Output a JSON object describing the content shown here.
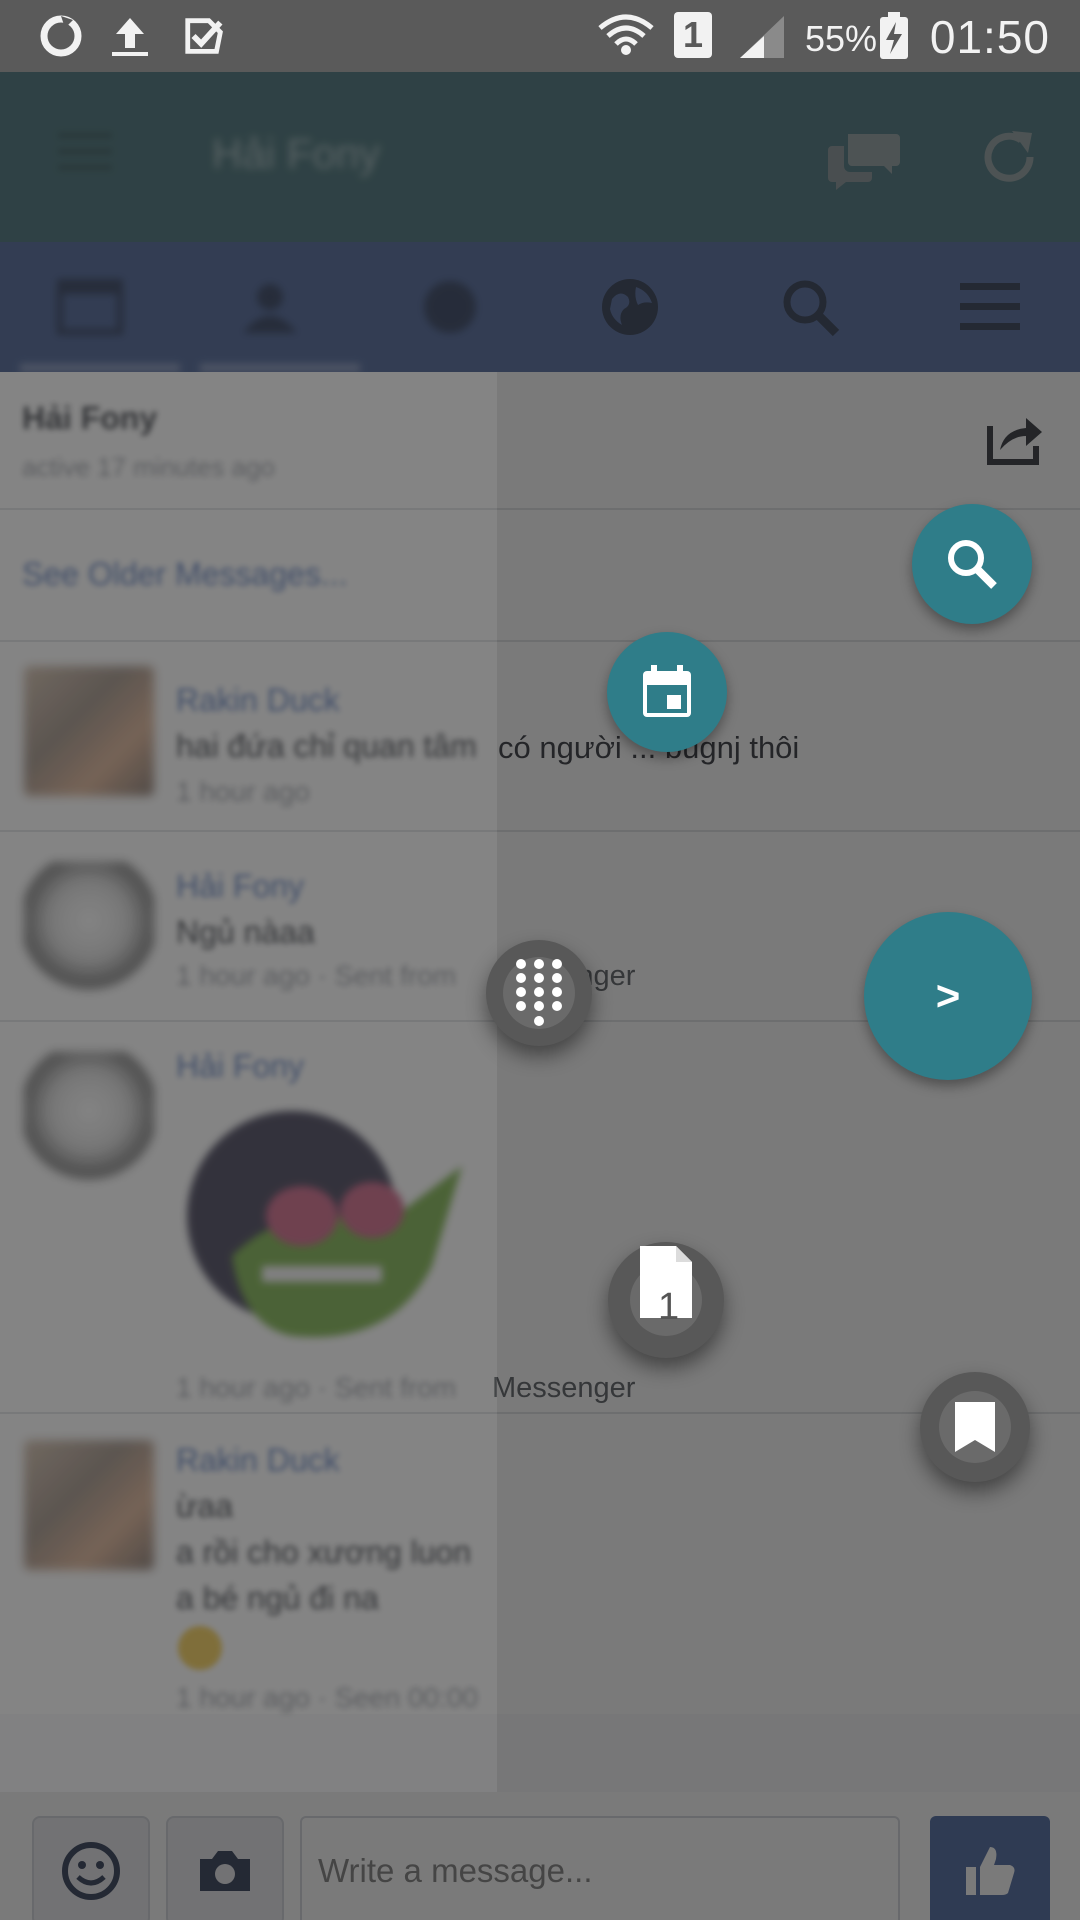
{
  "status_bar": {
    "time": "01:50",
    "battery_percent": "55%",
    "sim_slot": "1",
    "icons": [
      "sync-icon",
      "upload-icon",
      "task-done-icon",
      "wifi-icon",
      "sim-icon",
      "signal-icon",
      "battery-charging-icon"
    ]
  },
  "app_bar": {
    "title": "Hải Fony",
    "icons": [
      "menu-icon",
      "chat-bubbles-icon",
      "refresh-icon"
    ]
  },
  "nav_tabs": [
    {
      "name": "news-feed",
      "icon": "newspaper-icon"
    },
    {
      "name": "friends",
      "icon": "friends-icon"
    },
    {
      "name": "messages",
      "icon": "messenger-icon"
    },
    {
      "name": "notifications",
      "icon": "globe-icon"
    },
    {
      "name": "search",
      "icon": "search-icon"
    },
    {
      "name": "more",
      "icon": "hamburger-icon"
    }
  ],
  "thread": {
    "name": "Hải Fony",
    "status": "active 17 minutes ago",
    "see_older": "See Older Messages..."
  },
  "messages": [
    {
      "sender": "Rakin Duck",
      "text_hidden": "hai đứa chỉ quan tâm",
      "text_visible": "có người ... bugnj thôi",
      "meta_hidden": "1 hour ago",
      "meta_visible": ""
    },
    {
      "sender": "Hải Fony",
      "text_hidden": "Ngủ nàaa",
      "text_visible": "",
      "meta_hidden": "1 hour ago · Sent from",
      "meta_visible": "Messenger"
    },
    {
      "sender": "Hải Fony",
      "text_hidden": "",
      "text_visible": "",
      "meta_hidden": "1 hour ago · Sent from",
      "meta_visible": "Messenger",
      "sticker": "green-monster-sticker"
    },
    {
      "sender": "Rakin Duck",
      "lines": [
        "ừaa",
        "a rồi cho xương luon",
        "a bé ngủ đi na"
      ],
      "emoji": "smile-emoji",
      "meta_hidden": "1 hour ago · Seen 00:00"
    }
  ],
  "compose": {
    "placeholder": "Write a message...",
    "icons": [
      "emoji-icon",
      "camera-icon",
      "like-icon"
    ]
  },
  "floating_buttons": {
    "search": "search-icon",
    "calendar": "calendar-icon",
    "dialpad": "dialpad-icon",
    "next_label": ">",
    "sim_card_label": "1",
    "bookmark": "bookmark-icon"
  },
  "colors": {
    "accent_teal": "#2f7d89",
    "appbar": "#3b6b73",
    "navbar": "#45609a",
    "link_blue": "#4267b2",
    "like_blue": "#3b5998"
  }
}
